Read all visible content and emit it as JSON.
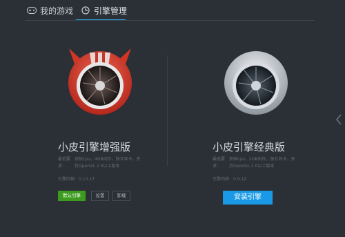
{
  "tabs": [
    {
      "label": "我的游戏",
      "icon": "gamepad-icon"
    },
    {
      "label": "引擎管理",
      "icon": "engine-icon"
    }
  ],
  "engines": [
    {
      "name": "小皮引擎增强版",
      "req_label": "最低要求：",
      "req_text": "双核cpu，4GB内存，独立显卡，支持OpenGL 2.0以上版本",
      "version": "引擎内核：0.10.17",
      "buttons": {
        "default": "默认引擎",
        "settings": "设置",
        "uninstall": "卸载"
      },
      "icon": "red-jet-engine-icon"
    },
    {
      "name": "小皮引擎经典版",
      "req_label": "最低要求：",
      "req_text": "双核cpu，2GB内存，独立显卡，支持OpenGL 2.0以上版本",
      "version": "引擎内核：0.9.12",
      "buttons": {
        "install": "安装引擎"
      },
      "icon": "silver-jet-engine-icon"
    }
  ],
  "colors": {
    "accent": "#1a9ae6",
    "default_badge": "#3c9a1f",
    "background": "#2b3036"
  }
}
